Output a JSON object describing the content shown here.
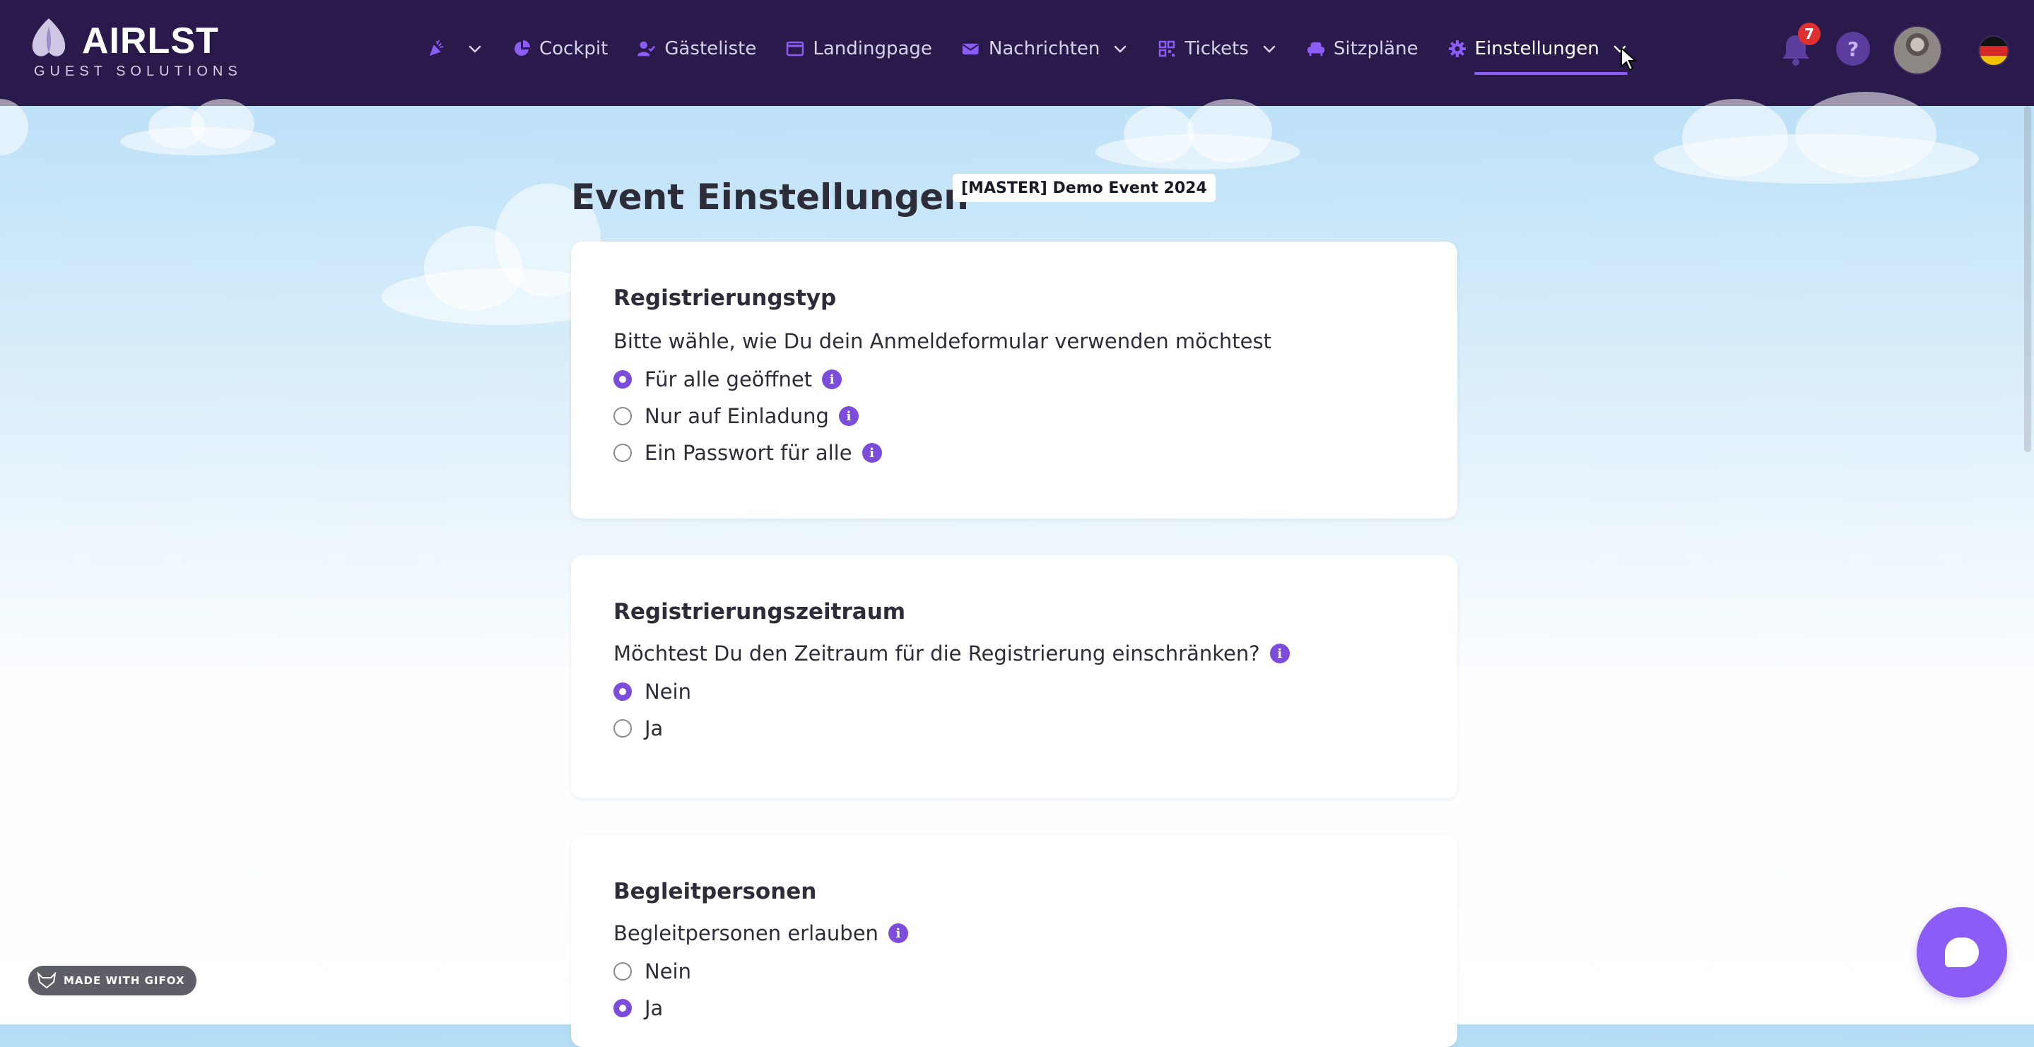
{
  "brand": {
    "name": "AIRLST",
    "tagline": "GUEST SOLUTIONS"
  },
  "nav": {
    "items": [
      {
        "label": "",
        "icon": "party-popper-icon",
        "dropdown": true
      },
      {
        "label": "Cockpit",
        "icon": "pie-chart-icon",
        "dropdown": false
      },
      {
        "label": "Gästeliste",
        "icon": "user-check-icon",
        "dropdown": false
      },
      {
        "label": "Landingpage",
        "icon": "browser-window-icon",
        "dropdown": false
      },
      {
        "label": "Nachrichten",
        "icon": "envelope-icon",
        "dropdown": true
      },
      {
        "label": "Tickets",
        "icon": "qr-code-icon",
        "dropdown": true
      },
      {
        "label": "Sitzpläne",
        "icon": "armchair-icon",
        "dropdown": false
      },
      {
        "label": "Einstellungen",
        "icon": "gear-icon",
        "dropdown": true,
        "active": true
      }
    ],
    "notifications_count": "7",
    "help_label": "?",
    "language": "de"
  },
  "page": {
    "title": "Event Einstellungen",
    "event_name": "[MASTER] Demo Event 2024"
  },
  "sections": {
    "registration_type": {
      "title": "Registrierungstyp",
      "question": "Bitte wähle, wie Du dein Anmeldeformular verwenden möchtest",
      "options": [
        {
          "label": "Für alle geöffnet",
          "selected": true
        },
        {
          "label": "Nur auf Einladung",
          "selected": false
        },
        {
          "label": "Ein Passwort für alle",
          "selected": false
        }
      ]
    },
    "registration_period": {
      "title": "Registrierungszeitraum",
      "question": "Möchtest Du den Zeitraum für die Registrierung einschränken?",
      "options": [
        {
          "label": "Nein",
          "selected": true
        },
        {
          "label": "Ja",
          "selected": false
        }
      ]
    },
    "companions": {
      "title": "Begleitpersonen",
      "question": "Begleitpersonen erlauben",
      "options": [
        {
          "label": "Nein",
          "selected": false
        },
        {
          "label": "Ja",
          "selected": true
        }
      ]
    }
  },
  "footer": {
    "gifox_label": "MADE WITH GIFOX"
  },
  "colors": {
    "navbar": "#2a1a4b",
    "accent": "#7c4ddb",
    "badge": "#e03131"
  }
}
